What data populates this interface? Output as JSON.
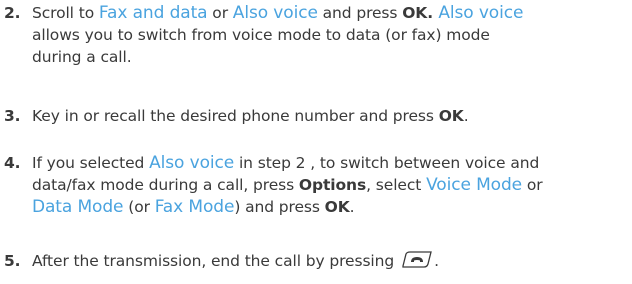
{
  "steps": [
    {
      "number": "2.",
      "parts": {
        "t1": "Scroll to ",
        "k1": "Fax and data",
        "t2": " or ",
        "k2": "Also voice",
        "t3": " and press ",
        "b1": "OK",
        "t4": ". ",
        "k3": "Also voice",
        "line2": "allows you to switch from voice mode to data (or fax) mode",
        "line3": "during a call."
      }
    },
    {
      "number": "3.",
      "parts": {
        "t1": "Key in or recall the desired phone number and press ",
        "b1": "OK",
        "t2": "."
      }
    },
    {
      "number": "4.",
      "parts": {
        "t1": "If you selected ",
        "k1": "Also voice",
        "t2": " in step 2 , to switch between voice and",
        "l2a": "data/fax mode during a call, press ",
        "b1": "Options",
        "l2b": ", select ",
        "k2": "Voice Mode",
        "l2c": " or",
        "k3": "Data Mode",
        "l3a": " (or ",
        "k4": "Fax Mode",
        "l3b": ") and press ",
        "b2": "OK",
        "l3c": "."
      }
    },
    {
      "number": "5.",
      "parts": {
        "t1": "After the transmission, end the call by pressing",
        "t2": "."
      }
    }
  ],
  "icons": {
    "end_key": "end-call-key-icon"
  },
  "colors": {
    "text": "#3a3a3a",
    "keyword": "#4aa3df"
  }
}
